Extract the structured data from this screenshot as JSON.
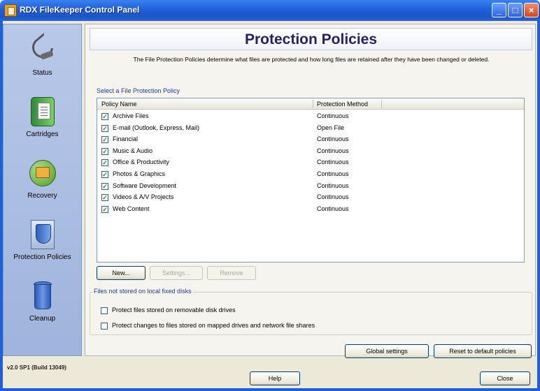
{
  "window": {
    "title": "RDX FileKeeper Control Panel"
  },
  "sidebar": {
    "items": [
      {
        "label": "Status",
        "icon": "stethoscope-icon"
      },
      {
        "label": "Cartridges",
        "icon": "cartridge-icon"
      },
      {
        "label": "Recovery",
        "icon": "recovery-icon"
      },
      {
        "label": "Protection Policies",
        "icon": "shield-icon"
      },
      {
        "label": "Cleanup",
        "icon": "trash-icon"
      }
    ],
    "version": "v2.0 SP1 (Build 13049)"
  },
  "main": {
    "title": "Protection Policies",
    "description": "The File Protection Policies determine what files are protected and how long files are retained after they have been changed or deleted.",
    "select_label": "Select a File Protection Policy",
    "columns": [
      "Policy Name",
      "Protection Method"
    ],
    "policies": [
      {
        "name": "Archive Files",
        "method": "Continuous",
        "checked": true
      },
      {
        "name": "E-mail (Outlook, Express, Mail)",
        "method": "Open File",
        "checked": true
      },
      {
        "name": "Financial",
        "method": "Continuous",
        "checked": true
      },
      {
        "name": "Music & Audio",
        "method": "Continuous",
        "checked": true
      },
      {
        "name": "Office & Productivity",
        "method": "Continuous",
        "checked": true
      },
      {
        "name": "Photos & Graphics",
        "method": "Continuous",
        "checked": true
      },
      {
        "name": "Software Development",
        "method": "Continuous",
        "checked": true
      },
      {
        "name": "Videos & A/V Projects",
        "method": "Continuous",
        "checked": true
      },
      {
        "name": "Web Content",
        "method": "Continuous",
        "checked": true
      }
    ],
    "buttons": {
      "new": "New...",
      "settings": "Settings...",
      "remove": "Remove"
    },
    "group_label": "Files not stored on local fixed disks",
    "options": [
      {
        "label": "Protect files stored on removable disk drives",
        "checked": false
      },
      {
        "label": "Protect changes to files stored on mapped drives and network file shares",
        "checked": false
      }
    ],
    "global_settings": "Global settings",
    "reset": "Reset to default policies"
  },
  "footer": {
    "help": "Help",
    "close": "Close"
  }
}
